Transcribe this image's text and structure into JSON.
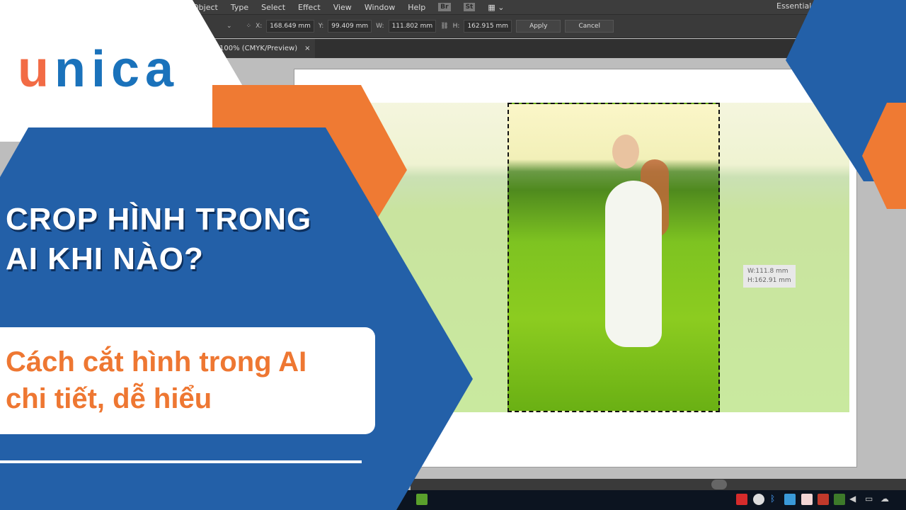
{
  "app": {
    "menu": [
      "Object",
      "Type",
      "Select",
      "Effect",
      "View",
      "Window",
      "Help"
    ],
    "menu_icons": [
      "Br",
      "St"
    ],
    "workspace": "Essentials",
    "control": {
      "x_label": "X:",
      "x": "168.649 mm",
      "y_label": "Y:",
      "y": "99.409 mm",
      "w_label": "W:",
      "w": "111.802 mm",
      "h_label": "H:",
      "h": "162.915 mm",
      "apply": "Apply",
      "cancel": "Cancel"
    },
    "tab": {
      "label": "100% (CMYK/Preview)",
      "close": "×"
    },
    "dims_tooltip": {
      "w": "W:111.8 mm",
      "h": "H:162.91 mm"
    }
  },
  "banner": {
    "logo": "unica",
    "title_line1": "CROP HÌNH TRONG",
    "title_line2": "AI KHI NÀO?",
    "subtitle_line1": "Cách cắt hình trong AI",
    "subtitle_line2": "chi tiết, dễ hiểu"
  },
  "colors": {
    "blue": "#2360a8",
    "orange": "#ef7a33",
    "logo_orange": "#f26b45",
    "logo_blue": "#1a72bb"
  }
}
